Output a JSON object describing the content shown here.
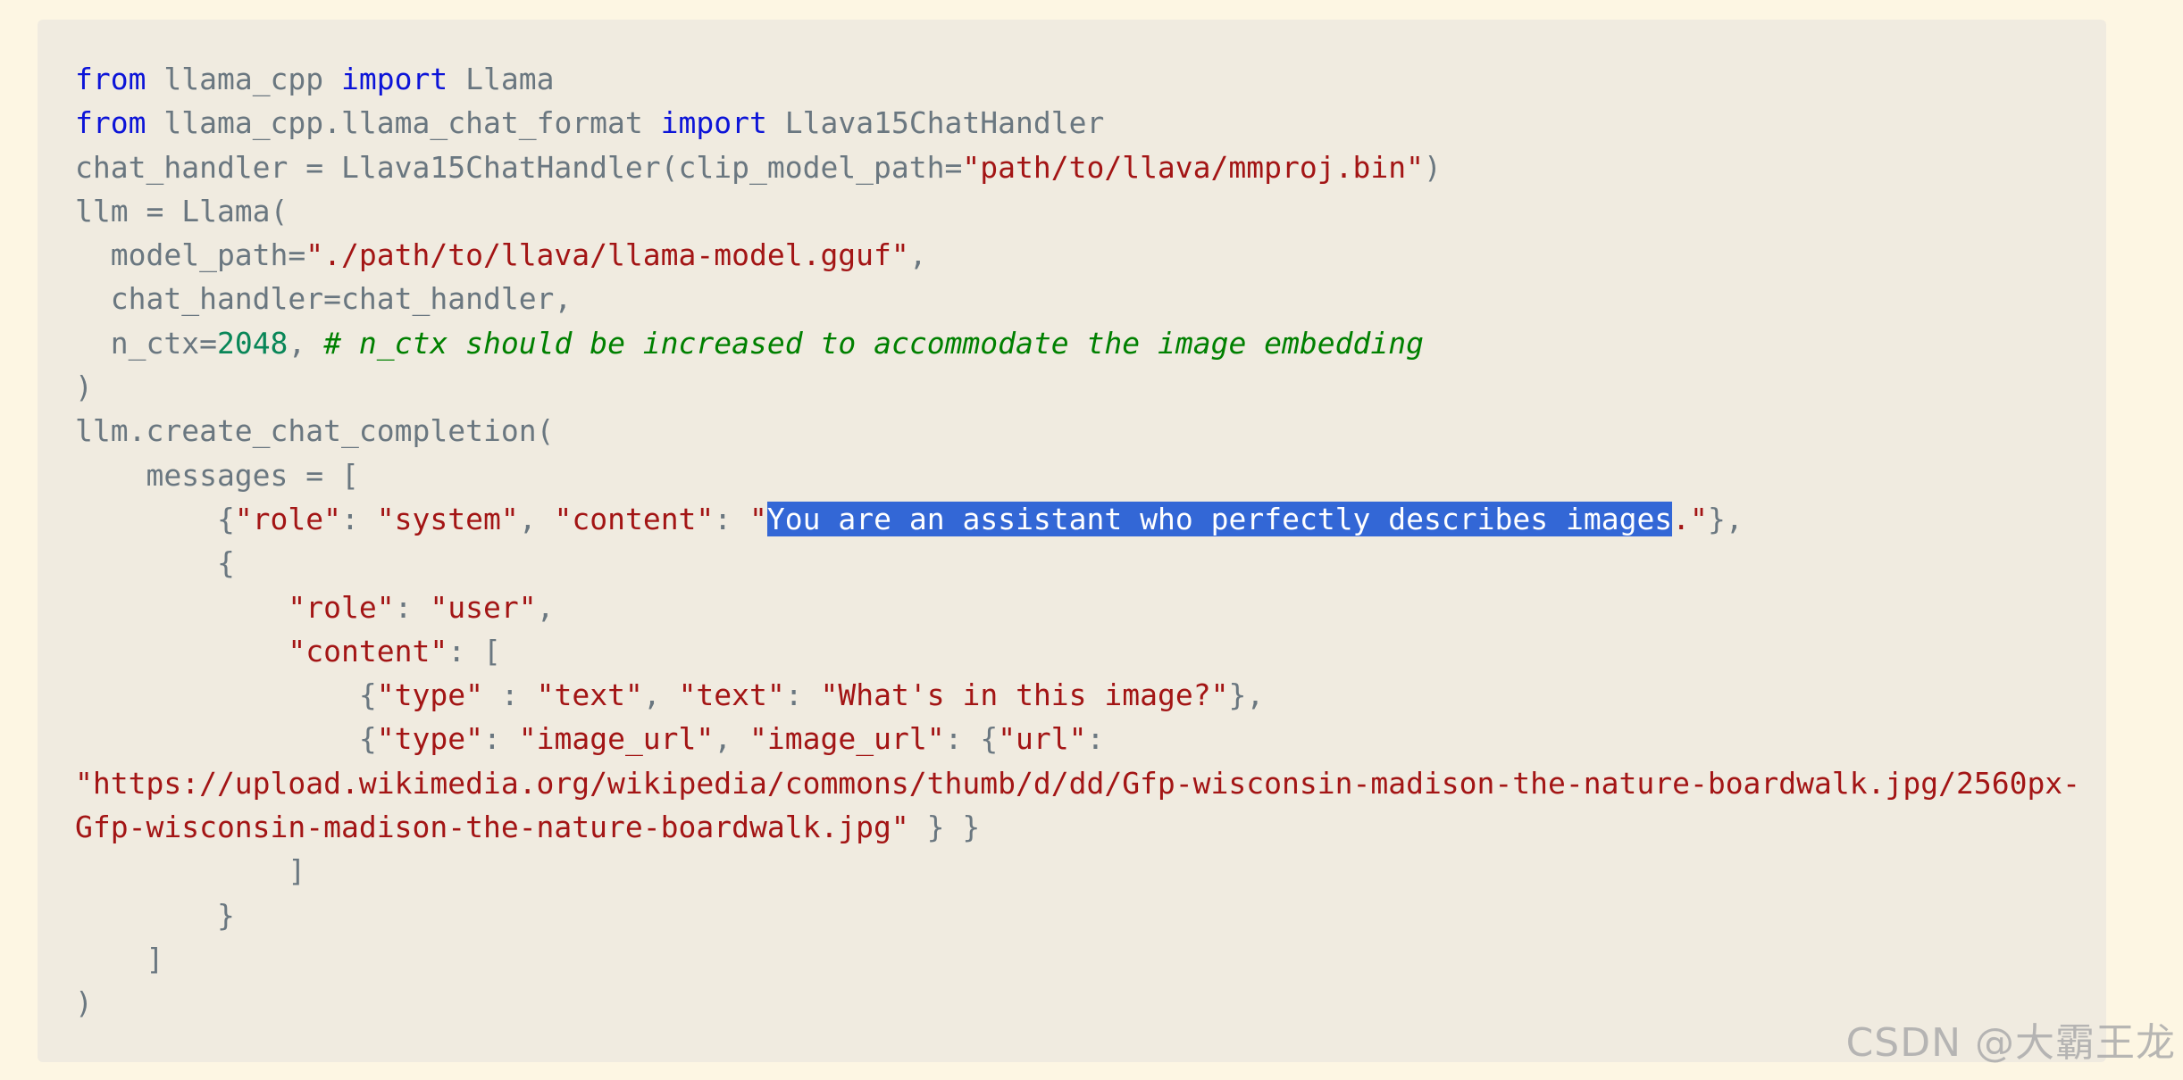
{
  "colors": {
    "page_background": "#fdf6e3",
    "code_background": "#f0ebe0",
    "plain_text": "#6a7780",
    "keyword": "#0c14d8",
    "string": "#a31515",
    "number": "#098658",
    "comment": "#008000",
    "selection": "#3367d6"
  },
  "code": {
    "lines": [
      [
        {
          "t": "kw",
          "v": "from"
        },
        {
          "t": "p",
          "v": " llama_cpp "
        },
        {
          "t": "kw",
          "v": "import"
        },
        {
          "t": "p",
          "v": " Llama"
        }
      ],
      [
        {
          "t": "kw",
          "v": "from"
        },
        {
          "t": "p",
          "v": " llama_cpp.llama_chat_format "
        },
        {
          "t": "kw",
          "v": "import"
        },
        {
          "t": "p",
          "v": " Llava15ChatHandler"
        }
      ],
      [
        {
          "t": "p",
          "v": "chat_handler = Llava15ChatHandler(clip_model_path="
        },
        {
          "t": "str",
          "v": "\"path/to/llava/mmproj.bin\""
        },
        {
          "t": "p",
          "v": ")"
        }
      ],
      [
        {
          "t": "p",
          "v": "llm = Llama("
        }
      ],
      [
        {
          "t": "p",
          "v": "  model_path="
        },
        {
          "t": "str",
          "v": "\"./path/to/llava/llama-model.gguf\""
        },
        {
          "t": "p",
          "v": ","
        }
      ],
      [
        {
          "t": "p",
          "v": "  chat_handler=chat_handler,"
        }
      ],
      [
        {
          "t": "p",
          "v": "  n_ctx="
        },
        {
          "t": "num",
          "v": "2048"
        },
        {
          "t": "p",
          "v": ", "
        },
        {
          "t": "com",
          "v": "# n_ctx should be increased to accommodate the image embedding"
        }
      ],
      [
        {
          "t": "p",
          "v": ")"
        }
      ],
      [
        {
          "t": "p",
          "v": "llm.create_chat_completion("
        }
      ],
      [
        {
          "t": "p",
          "v": "    messages = ["
        }
      ],
      [
        {
          "t": "p",
          "v": "        {"
        },
        {
          "t": "str",
          "v": "\"role\""
        },
        {
          "t": "p",
          "v": ": "
        },
        {
          "t": "str",
          "v": "\"system\""
        },
        {
          "t": "p",
          "v": ", "
        },
        {
          "t": "str",
          "v": "\"content\""
        },
        {
          "t": "p",
          "v": ": "
        },
        {
          "t": "str",
          "v": "\""
        },
        {
          "t": "sel",
          "v": "You are an assistant who perfectly describes images"
        },
        {
          "t": "str",
          "v": ".\""
        },
        {
          "t": "p",
          "v": "},"
        }
      ],
      [
        {
          "t": "p",
          "v": "        {"
        }
      ],
      [
        {
          "t": "p",
          "v": "            "
        },
        {
          "t": "str",
          "v": "\"role\""
        },
        {
          "t": "p",
          "v": ": "
        },
        {
          "t": "str",
          "v": "\"user\""
        },
        {
          "t": "p",
          "v": ","
        }
      ],
      [
        {
          "t": "p",
          "v": "            "
        },
        {
          "t": "str",
          "v": "\"content\""
        },
        {
          "t": "p",
          "v": ": ["
        }
      ],
      [
        {
          "t": "p",
          "v": "                {"
        },
        {
          "t": "str",
          "v": "\"type\""
        },
        {
          "t": "p",
          "v": " : "
        },
        {
          "t": "str",
          "v": "\"text\""
        },
        {
          "t": "p",
          "v": ", "
        },
        {
          "t": "str",
          "v": "\"text\""
        },
        {
          "t": "p",
          "v": ": "
        },
        {
          "t": "str",
          "v": "\"What's in this image?\""
        },
        {
          "t": "p",
          "v": "},"
        }
      ],
      [
        {
          "t": "p",
          "v": "                {"
        },
        {
          "t": "str",
          "v": "\"type\""
        },
        {
          "t": "p",
          "v": ": "
        },
        {
          "t": "str",
          "v": "\"image_url\""
        },
        {
          "t": "p",
          "v": ", "
        },
        {
          "t": "str",
          "v": "\"image_url\""
        },
        {
          "t": "p",
          "v": ": {"
        },
        {
          "t": "str",
          "v": "\"url\""
        },
        {
          "t": "p",
          "v": ":"
        }
      ],
      [
        {
          "t": "str",
          "v": "\"https://upload.wikimedia.org/wikipedia/commons/thumb/d/dd/Gfp-wisconsin-madison-the-nature-boardwalk.jpg/2560px-"
        }
      ],
      [
        {
          "t": "str",
          "v": "Gfp-wisconsin-madison-the-nature-boardwalk.jpg\""
        },
        {
          "t": "p",
          "v": " } }"
        }
      ],
      [
        {
          "t": "p",
          "v": "            ]"
        }
      ],
      [
        {
          "t": "p",
          "v": "        }"
        }
      ],
      [
        {
          "t": "p",
          "v": "    ]"
        }
      ],
      [
        {
          "t": "p",
          "v": ")"
        }
      ]
    ]
  },
  "watermark": {
    "text": "CSDN @大霸王龙"
  }
}
